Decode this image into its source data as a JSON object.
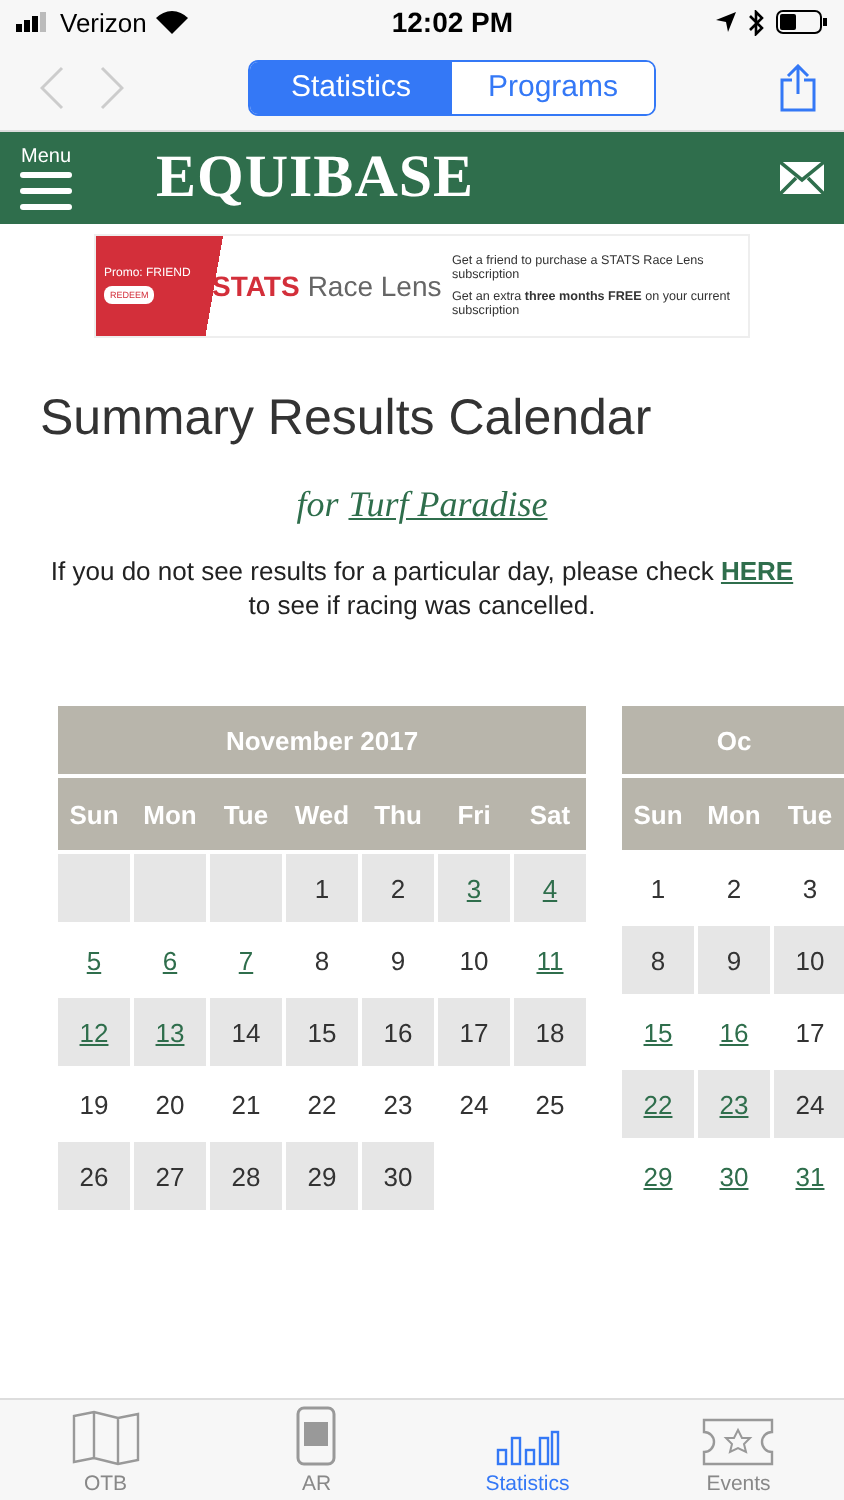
{
  "status_bar": {
    "carrier": "Verizon",
    "time": "12:02 PM"
  },
  "nav_bar": {
    "segments": [
      {
        "label": "Statistics",
        "selected": true
      },
      {
        "label": "Programs",
        "selected": false
      }
    ]
  },
  "header": {
    "menu_label": "Menu",
    "logo": "EQUIBASE"
  },
  "banner": {
    "promo": "Promo: FRIEND",
    "redeem": "REDEEM",
    "brand_bold": "STATS",
    "brand_light": "Race Lens",
    "points": [
      "Get a friend to purchase a STATS Race Lens subscription",
      "Get an extra **three months FREE** on your current subscription"
    ]
  },
  "title": "Summary Results Calendar",
  "subtitle": {
    "prefix": "for",
    "track": "Turf Paradise"
  },
  "notice": {
    "before": "If you do not see results for a particular day, please check",
    "link": "HERE",
    "after": "to see if racing was cancelled."
  },
  "calendars": [
    {
      "month": "November 2017",
      "weekdays": [
        "Sun",
        "Mon",
        "Tue",
        "Wed",
        "Thu",
        "Fri",
        "Sat"
      ],
      "weeks": [
        [
          {
            "kind": "blank",
            "shaded": true
          },
          {
            "kind": "blank",
            "shaded": true
          },
          {
            "kind": "blank",
            "shaded": true
          },
          {
            "kind": "day",
            "day": "1",
            "linked": false,
            "shaded": true
          },
          {
            "kind": "day",
            "day": "2",
            "linked": false,
            "shaded": true
          },
          {
            "kind": "day",
            "day": "3",
            "linked": true,
            "shaded": true
          },
          {
            "kind": "day",
            "day": "4",
            "linked": true,
            "shaded": true
          }
        ],
        [
          {
            "kind": "day",
            "day": "5",
            "linked": true,
            "shaded": false
          },
          {
            "kind": "day",
            "day": "6",
            "linked": true,
            "shaded": false
          },
          {
            "kind": "day",
            "day": "7",
            "linked": true,
            "shaded": false
          },
          {
            "kind": "day",
            "day": "8",
            "linked": false,
            "shaded": false
          },
          {
            "kind": "day",
            "day": "9",
            "linked": false,
            "shaded": false
          },
          {
            "kind": "day",
            "day": "10",
            "linked": false,
            "shaded": false
          },
          {
            "kind": "day",
            "day": "11",
            "linked": true,
            "shaded": false
          }
        ],
        [
          {
            "kind": "day",
            "day": "12",
            "linked": true,
            "shaded": true
          },
          {
            "kind": "day",
            "day": "13",
            "linked": true,
            "shaded": true
          },
          {
            "kind": "day",
            "day": "14",
            "linked": false,
            "shaded": true
          },
          {
            "kind": "day",
            "day": "15",
            "linked": false,
            "shaded": true
          },
          {
            "kind": "day",
            "day": "16",
            "linked": false,
            "shaded": true
          },
          {
            "kind": "day",
            "day": "17",
            "linked": false,
            "shaded": true
          },
          {
            "kind": "day",
            "day": "18",
            "linked": false,
            "shaded": true
          }
        ],
        [
          {
            "kind": "day",
            "day": "19",
            "linked": false,
            "shaded": false
          },
          {
            "kind": "day",
            "day": "20",
            "linked": false,
            "shaded": false
          },
          {
            "kind": "day",
            "day": "21",
            "linked": false,
            "shaded": false
          },
          {
            "kind": "day",
            "day": "22",
            "linked": false,
            "shaded": false
          },
          {
            "kind": "day",
            "day": "23",
            "linked": false,
            "shaded": false
          },
          {
            "kind": "day",
            "day": "24",
            "linked": false,
            "shaded": false
          },
          {
            "kind": "day",
            "day": "25",
            "linked": false,
            "shaded": false
          }
        ],
        [
          {
            "kind": "day",
            "day": "26",
            "linked": false,
            "shaded": true
          },
          {
            "kind": "day",
            "day": "27",
            "linked": false,
            "shaded": true
          },
          {
            "kind": "day",
            "day": "28",
            "linked": false,
            "shaded": true
          },
          {
            "kind": "day",
            "day": "29",
            "linked": false,
            "shaded": true
          },
          {
            "kind": "day",
            "day": "30",
            "linked": false,
            "shaded": true
          }
        ]
      ]
    },
    {
      "month": "Oc",
      "weekdays": [
        "Sun",
        "Mon",
        "Tue"
      ],
      "weeks": [
        [
          {
            "kind": "day",
            "day": "1",
            "linked": false,
            "shaded": false
          },
          {
            "kind": "day",
            "day": "2",
            "linked": false,
            "shaded": false
          },
          {
            "kind": "day",
            "day": "3",
            "linked": false,
            "shaded": false
          }
        ],
        [
          {
            "kind": "day",
            "day": "8",
            "linked": false,
            "shaded": true
          },
          {
            "kind": "day",
            "day": "9",
            "linked": false,
            "shaded": true
          },
          {
            "kind": "day",
            "day": "10",
            "linked": false,
            "shaded": true
          }
        ],
        [
          {
            "kind": "day",
            "day": "15",
            "linked": true,
            "shaded": false
          },
          {
            "kind": "day",
            "day": "16",
            "linked": true,
            "shaded": false
          },
          {
            "kind": "day",
            "day": "17",
            "linked": false,
            "shaded": false
          }
        ],
        [
          {
            "kind": "day",
            "day": "22",
            "linked": true,
            "shaded": true
          },
          {
            "kind": "day",
            "day": "23",
            "linked": true,
            "shaded": true
          },
          {
            "kind": "day",
            "day": "24",
            "linked": false,
            "shaded": true
          }
        ],
        [
          {
            "kind": "day",
            "day": "29",
            "linked": true,
            "shaded": false
          },
          {
            "kind": "day",
            "day": "30",
            "linked": true,
            "shaded": false
          },
          {
            "kind": "day",
            "day": "31",
            "linked": true,
            "shaded": false
          }
        ]
      ]
    }
  ],
  "tab_bar": [
    {
      "kind": "map",
      "label": "OTB",
      "selected": false
    },
    {
      "kind": "ar",
      "label": "AR",
      "selected": false
    },
    {
      "kind": "stats",
      "label": "Statistics",
      "selected": true
    },
    {
      "kind": "ticket",
      "label": "Events",
      "selected": false
    }
  ]
}
